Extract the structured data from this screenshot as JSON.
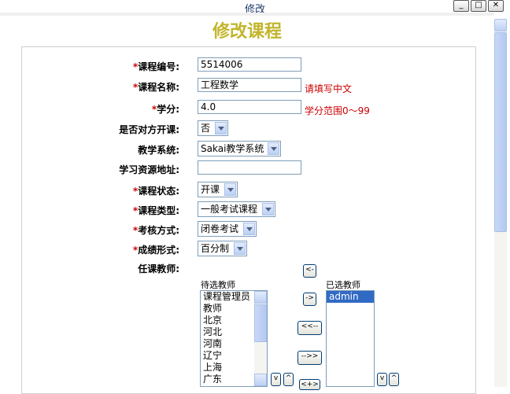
{
  "window": {
    "title": "修改",
    "min": "_",
    "max": "□",
    "close": "✕"
  },
  "page_title": "修改课程",
  "form": {
    "course_code": {
      "req": "*",
      "label": "课程编号:",
      "value": "5514006"
    },
    "course_name": {
      "req": "*",
      "label": "课程名称:",
      "value": "工程数学",
      "hint": "请填写中文"
    },
    "credit": {
      "req": "*",
      "label": "学分:",
      "value": "4.0",
      "hint": "学分范围0～99"
    },
    "open_external": {
      "label": "是否对方开课:",
      "value": "否"
    },
    "teaching_system": {
      "label": "教学系统:",
      "value": "Sakai教学系统"
    },
    "resource_url": {
      "label": "学习资源地址:",
      "value": ""
    },
    "course_status": {
      "req": "*",
      "label": "课程状态:",
      "value": "开课"
    },
    "course_type": {
      "req": "*",
      "label": "课程类型:",
      "value": "一般考试课程"
    },
    "exam_method": {
      "req": "*",
      "label": "考核方式:",
      "value": "闭卷考试"
    },
    "grade_form": {
      "req": "*",
      "label": "成绩形式:",
      "value": "百分制"
    },
    "teachers": {
      "label": "任课教师:",
      "available_title": "待选教师",
      "selected_title": "已选教师",
      "available": [
        "课程管理员",
        "教师",
        "北京",
        "河北",
        "河南",
        "辽宁",
        "上海",
        "广东"
      ],
      "selected": [
        "admin"
      ],
      "btn_remove": "<-",
      "btn_add": "->",
      "btn_remove_all": "<<--",
      "btn_add_all": "-->>",
      "btn_down": "v",
      "btn_up": "^",
      "btn_partial": "<+>"
    }
  }
}
